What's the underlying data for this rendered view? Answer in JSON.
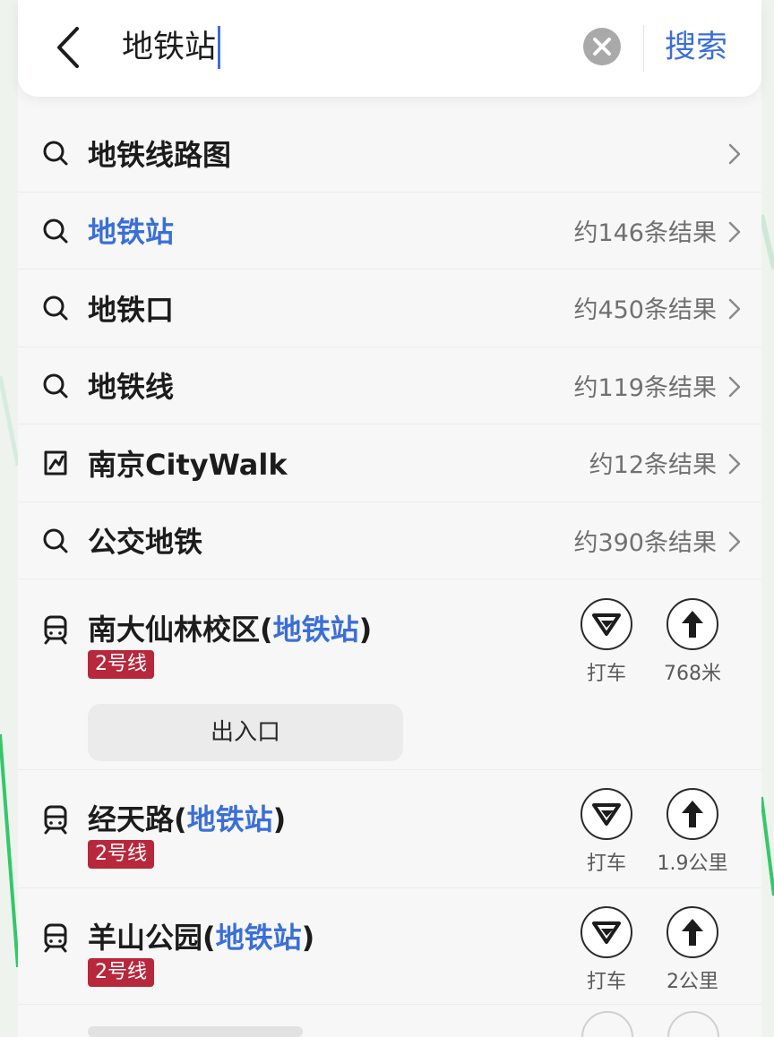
{
  "search": {
    "query": "地铁站",
    "submit_label": "搜索"
  },
  "suggestions": [
    {
      "icon": "search-icon",
      "label": "地铁线路图",
      "count": "",
      "highlight": false
    },
    {
      "icon": "search-icon",
      "label": "地铁站",
      "count": "约146条结果",
      "highlight": true
    },
    {
      "icon": "search-icon",
      "label": "地铁口",
      "count": "约450条结果",
      "highlight": false
    },
    {
      "icon": "search-icon",
      "label": "地铁线",
      "count": "约119条结果",
      "highlight": false
    },
    {
      "icon": "map-pin-square-icon",
      "label": "南京CityWalk",
      "count": "约12条结果",
      "highlight": false
    },
    {
      "icon": "search-icon",
      "label": "公交地铁",
      "count": "约390条结果",
      "highlight": false
    }
  ],
  "stations": [
    {
      "name": "南大仙林校区",
      "open_paren": "(",
      "tag": "地铁站",
      "close_paren": ")",
      "line": "2号线",
      "taxi_label": "打车",
      "distance": "768米",
      "exit_label": "出入口"
    },
    {
      "name": "经天路",
      "open_paren": "(",
      "tag": "地铁站",
      "close_paren": ")",
      "line": "2号线",
      "taxi_label": "打车",
      "distance": "1.9公里"
    },
    {
      "name": "羊山公园",
      "open_paren": "(",
      "tag": "地铁站",
      "close_paren": ")",
      "line": "2号线",
      "taxi_label": "打车",
      "distance": "2公里"
    }
  ],
  "colors": {
    "accent": "#3b6fd8",
    "line2_badge": "#b8283c",
    "map_green": "#35c76a"
  }
}
